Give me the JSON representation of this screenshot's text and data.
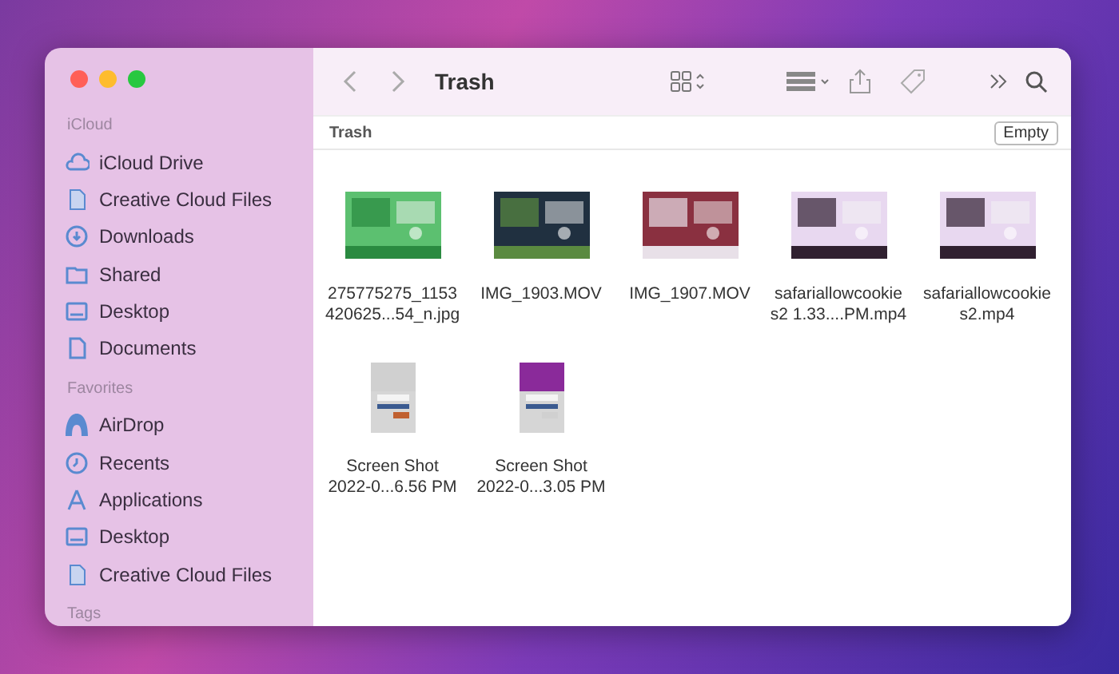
{
  "window": {
    "title": "Trash"
  },
  "sidebar": {
    "sections": [
      {
        "heading": "iCloud",
        "items": [
          {
            "label": "iCloud Drive",
            "kind": "cloud"
          },
          {
            "label": "Creative Cloud Files",
            "kind": "file"
          },
          {
            "label": "Downloads",
            "kind": "download"
          },
          {
            "label": "Shared",
            "kind": "folder"
          },
          {
            "label": "Desktop",
            "kind": "desktop"
          },
          {
            "label": "Documents",
            "kind": "document"
          }
        ]
      },
      {
        "heading": "Favorites",
        "items": [
          {
            "label": "AirDrop",
            "kind": "airdrop"
          },
          {
            "label": "Recents",
            "kind": "clock"
          },
          {
            "label": "Applications",
            "kind": "apps"
          },
          {
            "label": "Desktop",
            "kind": "desktop"
          },
          {
            "label": "Creative Cloud Files",
            "kind": "file"
          }
        ]
      },
      {
        "heading": "Tags"
      }
    ]
  },
  "path_bar": {
    "label": "Trash",
    "button": "Empty"
  },
  "files": [
    {
      "name_lines": [
        "275775275_1153",
        "420625...54_n.jpg"
      ],
      "kind": "landscape"
    },
    {
      "name_lines": [
        "IMG_1903.MOV"
      ],
      "kind": "landscape"
    },
    {
      "name_lines": [
        "IMG_1907.MOV"
      ],
      "kind": "landscape"
    },
    {
      "name_lines": [
        "safariallowcookie",
        "s2 1.33....PM.mp4"
      ],
      "kind": "landscape"
    },
    {
      "name_lines": [
        "safariallowcookie",
        "s2.mp4"
      ],
      "kind": "landscape"
    },
    {
      "name_lines": [
        "Screen Shot",
        "2022-0...6.56 PM"
      ],
      "kind": "portrait"
    },
    {
      "name_lines": [
        "Screen Shot",
        "2022-0...3.05 PM"
      ],
      "kind": "portrait"
    }
  ]
}
